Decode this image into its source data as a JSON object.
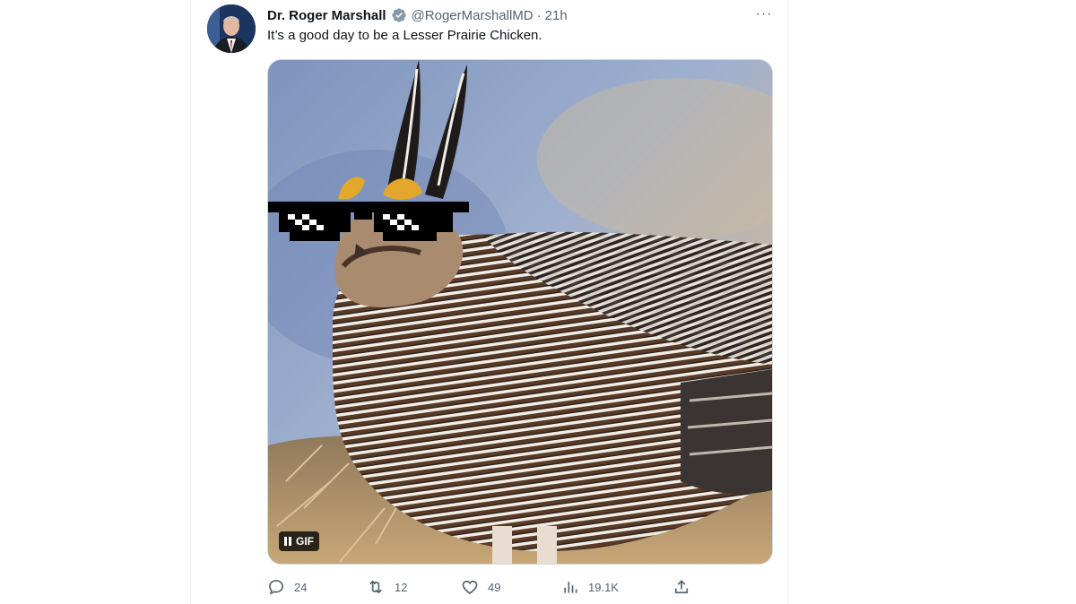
{
  "tweet": {
    "author_name": "Dr. Roger Marshall",
    "handle": "@RogerMarshallMD",
    "separator": "·",
    "time": "21h",
    "more": "···",
    "text": "It’s a good day to be a Lesser Prairie Chicken.",
    "media": {
      "badge_label": "GIF",
      "state": "playing"
    },
    "actions": {
      "replies": "24",
      "retweets": "12",
      "likes": "49",
      "views": "19.1K"
    }
  },
  "colors": {
    "text": "#0f1419",
    "secondary": "#536471",
    "verified": "#829aab",
    "border": "#cfd9de"
  }
}
